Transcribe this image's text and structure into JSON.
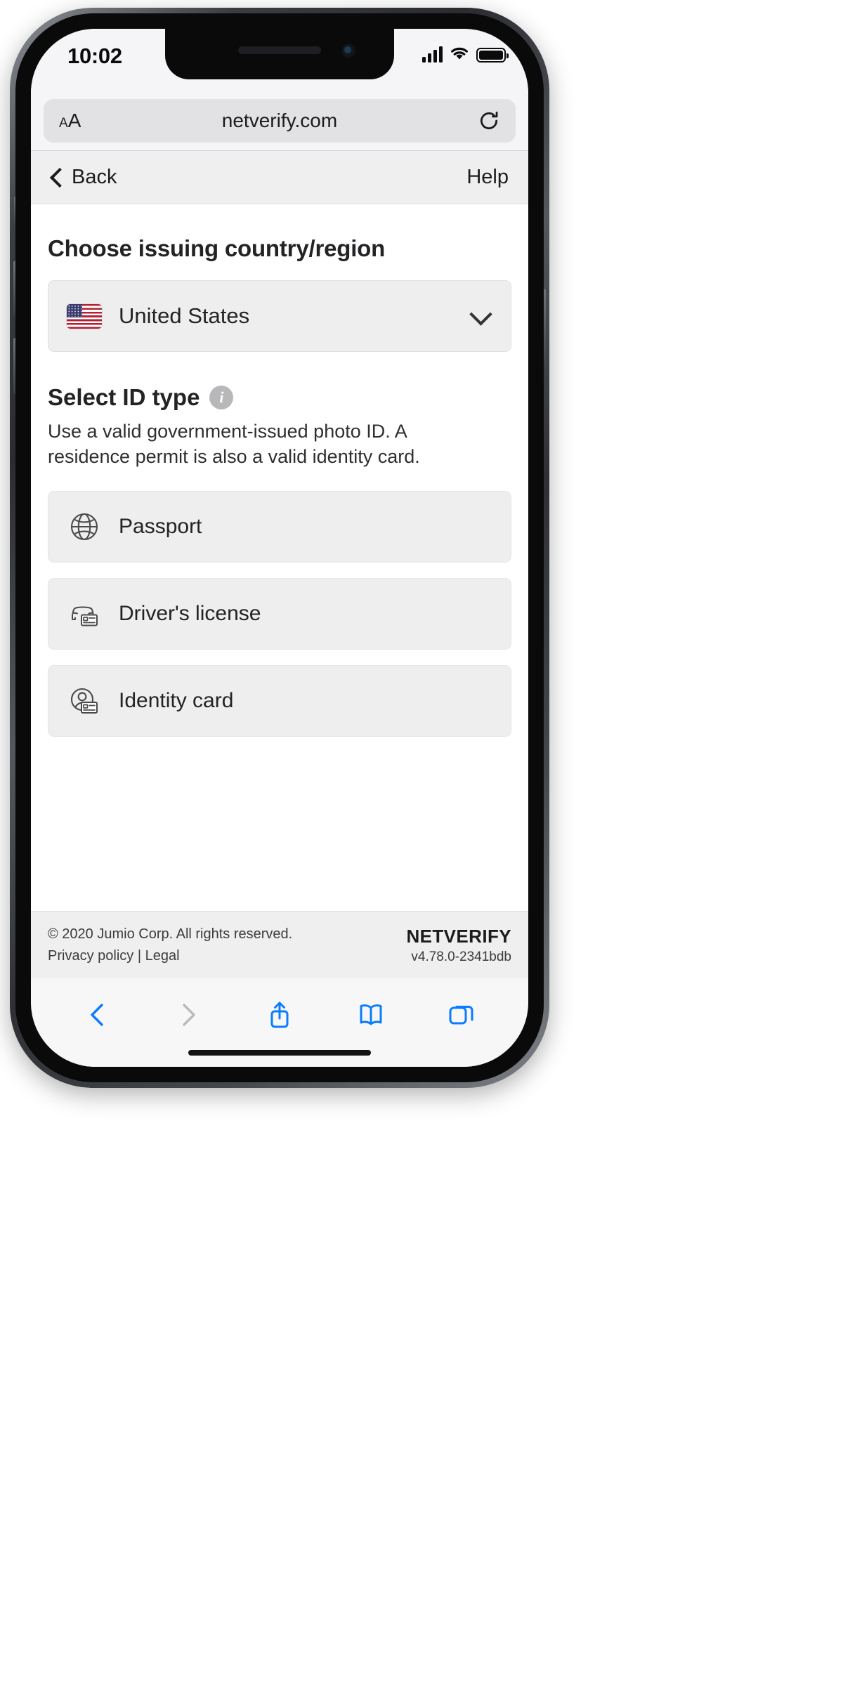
{
  "status_bar": {
    "time": "10:02",
    "signal_icon": "cellular-signal-icon",
    "wifi_icon": "wifi-icon",
    "battery_icon": "battery-full-icon"
  },
  "browser": {
    "text_size_small": "A",
    "text_size_large": "A",
    "url": "netverify.com",
    "reload_icon": "reload-icon"
  },
  "page_header": {
    "back_label": "Back",
    "back_icon": "chevron-left-icon",
    "help_label": "Help"
  },
  "main": {
    "country_heading": "Choose issuing country/region",
    "country_selected": "United States",
    "country_flag": "us-flag-icon",
    "country_chevron": "chevron-down-icon",
    "idtype_heading": "Select ID type",
    "idtype_info_icon": "info-icon",
    "idtype_description": "Use a valid government-issued photo ID. A residence permit is also a valid identity card.",
    "id_options": [
      {
        "label": "Passport",
        "icon": "globe-icon"
      },
      {
        "label": "Driver's license",
        "icon": "car-card-icon"
      },
      {
        "label": "Identity card",
        "icon": "person-card-icon"
      }
    ]
  },
  "footer": {
    "copyright": "© 2020 Jumio Corp. All rights reserved.",
    "privacy_label": "Privacy policy",
    "separator": "|",
    "legal_label": "Legal",
    "brand": "NETVERIFY",
    "version": "v4.78.0-2341bdb"
  },
  "toolbar": {
    "back_icon": "chevron-left-icon",
    "forward_icon": "chevron-right-icon",
    "share_icon": "share-icon",
    "bookmarks_icon": "book-icon",
    "tabs_icon": "tabs-icon",
    "accent": "#0a7cff",
    "disabled": "#b9babc"
  }
}
